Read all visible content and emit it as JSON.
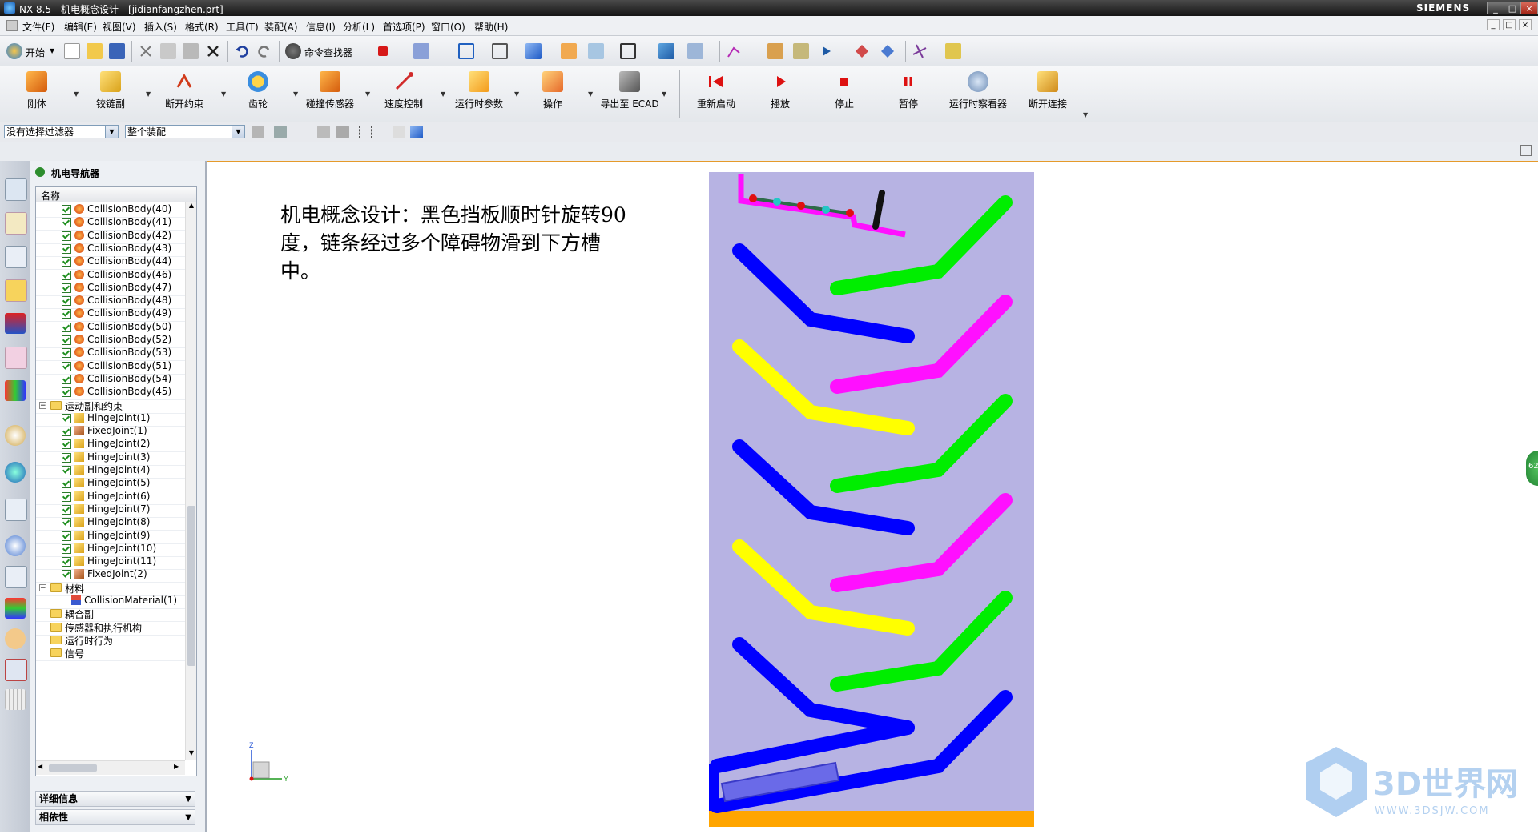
{
  "window": {
    "title": "NX 8.5 - 机电概念设计 - [jidianfangzhen.prt]",
    "brand": "SIEMENS",
    "controls": [
      "_",
      "□",
      "×"
    ]
  },
  "menu": {
    "items": [
      "文件(F)",
      "编辑(E)",
      "视图(V)",
      "插入(S)",
      "格式(R)",
      "工具(T)",
      "装配(A)",
      "信息(I)",
      "分析(L)",
      "首选项(P)",
      "窗口(O)",
      "帮助(H)"
    ]
  },
  "toolbar1": {
    "start_label": "开始",
    "cmd_finder_label": "命令查找器"
  },
  "toolbar2": {
    "buttons": [
      "刚体",
      "铰链副",
      "断开约束",
      "齿轮",
      "碰撞传感器",
      "速度控制",
      "运行时参数",
      "操作",
      "导出至 ECAD",
      "重新启动",
      "播放",
      "停止",
      "暂停",
      "运行时察看器",
      "断开连接"
    ]
  },
  "selection": {
    "filter_value": "没有选择过滤器",
    "scope_value": "整个装配"
  },
  "navigator": {
    "title": "机电导航器",
    "column_name": "名称",
    "rows": [
      {
        "type": "item",
        "icon": "collision-body-icon",
        "label": "CollisionBody(40)",
        "indent": 1
      },
      {
        "type": "item",
        "icon": "collision-body-icon",
        "label": "CollisionBody(41)",
        "indent": 1
      },
      {
        "type": "item",
        "icon": "collision-body-icon",
        "label": "CollisionBody(42)",
        "indent": 1
      },
      {
        "type": "item",
        "icon": "collision-body-icon",
        "label": "CollisionBody(43)",
        "indent": 1
      },
      {
        "type": "item",
        "icon": "collision-body-icon",
        "label": "CollisionBody(44)",
        "indent": 1
      },
      {
        "type": "item",
        "icon": "collision-body-icon",
        "label": "CollisionBody(46)",
        "indent": 1
      },
      {
        "type": "item",
        "icon": "collision-body-icon",
        "label": "CollisionBody(47)",
        "indent": 1
      },
      {
        "type": "item",
        "icon": "collision-body-icon",
        "label": "CollisionBody(48)",
        "indent": 1
      },
      {
        "type": "item",
        "icon": "collision-body-icon",
        "label": "CollisionBody(49)",
        "indent": 1
      },
      {
        "type": "item",
        "icon": "collision-body-icon",
        "label": "CollisionBody(50)",
        "indent": 1
      },
      {
        "type": "item",
        "icon": "collision-body-icon",
        "label": "CollisionBody(52)",
        "indent": 1
      },
      {
        "type": "item",
        "icon": "collision-body-icon",
        "label": "CollisionBody(53)",
        "indent": 1
      },
      {
        "type": "item",
        "icon": "collision-body-icon",
        "label": "CollisionBody(51)",
        "indent": 1
      },
      {
        "type": "item",
        "icon": "collision-body-icon",
        "label": "CollisionBody(54)",
        "indent": 1
      },
      {
        "type": "item",
        "icon": "collision-body-icon",
        "label": "CollisionBody(45)",
        "indent": 1
      },
      {
        "type": "folder",
        "label": "运动副和约束",
        "expanded": true
      },
      {
        "type": "item",
        "icon": "hinge-joint-icon",
        "label": "HingeJoint(1)",
        "indent": 1
      },
      {
        "type": "item",
        "icon": "fixed-joint-icon",
        "label": "FixedJoint(1)",
        "indent": 1
      },
      {
        "type": "item",
        "icon": "hinge-joint-icon",
        "label": "HingeJoint(2)",
        "indent": 1
      },
      {
        "type": "item",
        "icon": "hinge-joint-icon",
        "label": "HingeJoint(3)",
        "indent": 1
      },
      {
        "type": "item",
        "icon": "hinge-joint-icon",
        "label": "HingeJoint(4)",
        "indent": 1
      },
      {
        "type": "item",
        "icon": "hinge-joint-icon",
        "label": "HingeJoint(5)",
        "indent": 1
      },
      {
        "type": "item",
        "icon": "hinge-joint-icon",
        "label": "HingeJoint(6)",
        "indent": 1
      },
      {
        "type": "item",
        "icon": "hinge-joint-icon",
        "label": "HingeJoint(7)",
        "indent": 1
      },
      {
        "type": "item",
        "icon": "hinge-joint-icon",
        "label": "HingeJoint(8)",
        "indent": 1
      },
      {
        "type": "item",
        "icon": "hinge-joint-icon",
        "label": "HingeJoint(9)",
        "indent": 1
      },
      {
        "type": "item",
        "icon": "hinge-joint-icon",
        "label": "HingeJoint(10)",
        "indent": 1
      },
      {
        "type": "item",
        "icon": "hinge-joint-icon",
        "label": "HingeJoint(11)",
        "indent": 1
      },
      {
        "type": "item",
        "icon": "fixed-joint-icon",
        "label": "FixedJoint(2)",
        "indent": 1
      },
      {
        "type": "folder",
        "label": "材料",
        "expanded": true
      },
      {
        "type": "material",
        "icon": "collision-material-icon",
        "label": "CollisionMaterial(1)",
        "indent": 2
      },
      {
        "type": "folder",
        "label": "耦合副",
        "expanded": false
      },
      {
        "type": "folder",
        "label": "传感器和执行机构",
        "expanded": false
      },
      {
        "type": "folder",
        "label": "运行时行为",
        "expanded": false
      },
      {
        "type": "folder",
        "label": "信号",
        "expanded": false
      }
    ],
    "panels": [
      "详细信息",
      "相依性"
    ]
  },
  "viewport": {
    "note": "机电概念设计：黑色挡板顺时针旋转90度，链条经过多个障碍物滑到下方槽中。",
    "triad": {
      "z": "Z",
      "y": "Y"
    },
    "scene_colors": {
      "background": "#b7b3e3",
      "floor": "#ffa500",
      "blue": "#0000ff",
      "green": "#00ee00",
      "magenta": "#ff10ff",
      "yellow": "#ffff00"
    },
    "badge": "62"
  },
  "watermark": {
    "main": "3D世界网",
    "url": "WWW.3DSJW.COM"
  }
}
